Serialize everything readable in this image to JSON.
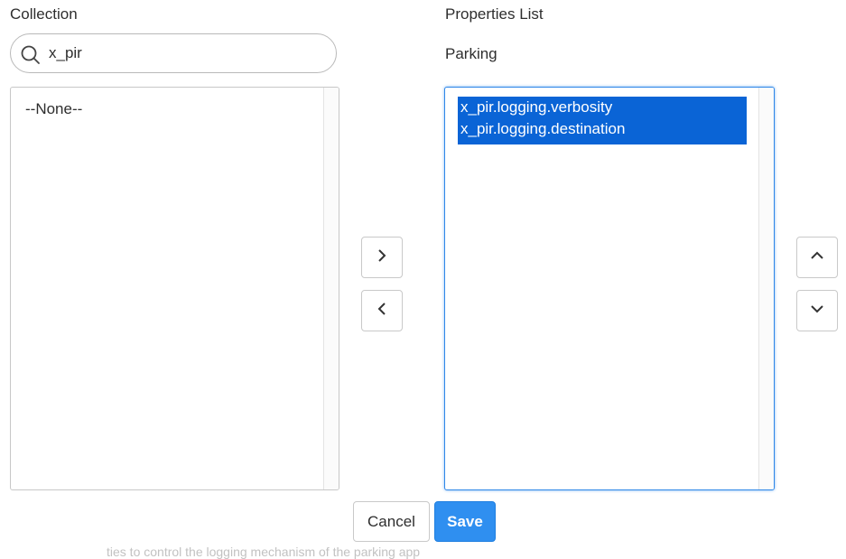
{
  "collection": {
    "label": "Collection",
    "search_value": "x_pir",
    "search_placeholder": "",
    "items": [
      "--None--"
    ]
  },
  "properties": {
    "label": "Properties List",
    "sublabel": "Parking",
    "items": [
      "x_pir.logging.verbosity",
      "x_pir.logging.destination"
    ]
  },
  "buttons": {
    "cancel": "Cancel",
    "save": "Save"
  },
  "icons": {
    "search": "search-icon",
    "add": "chevron-right-icon",
    "remove": "chevron-left-icon",
    "move_up": "chevron-up-icon",
    "move_down": "chevron-down-icon"
  },
  "colors": {
    "selection": "#0a64d6",
    "focus_border": "#2f87e8",
    "save_bg": "#2f8ff0"
  },
  "footer_caption": "ties to control the logging mechanism of the parking app"
}
